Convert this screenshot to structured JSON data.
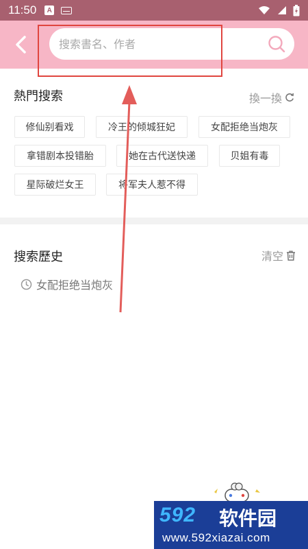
{
  "status_bar": {
    "time": "11:50",
    "a_badge": "A",
    "icons": [
      "keyboard-icon",
      "wifi-icon",
      "signal-icon",
      "battery-icon"
    ]
  },
  "header": {
    "search_placeholder": "搜索書名、作者",
    "search_value": "",
    "icons": [
      "back-arrow-icon",
      "search-icon"
    ],
    "colors": {
      "status_bar": "#a8606f",
      "header": "#f7b6c6",
      "highlight": "#e0453f"
    }
  },
  "hot_search": {
    "title": "熱門搜索",
    "refresh_label": "換一換",
    "tags": [
      "修仙别看戏",
      "冷王的倾城狂妃",
      "女配拒绝当炮灰",
      "拿错剧本投错胎",
      "她在古代送快递",
      "贝姐有毒",
      "星际破烂女王",
      "将军夫人惹不得"
    ]
  },
  "history": {
    "title": "搜索歷史",
    "clear_label": "清空",
    "items": [
      "女配拒绝当炮灰"
    ]
  },
  "watermark": {
    "logo": "592",
    "name": "软件园",
    "url": "www.592xiazai.com"
  }
}
